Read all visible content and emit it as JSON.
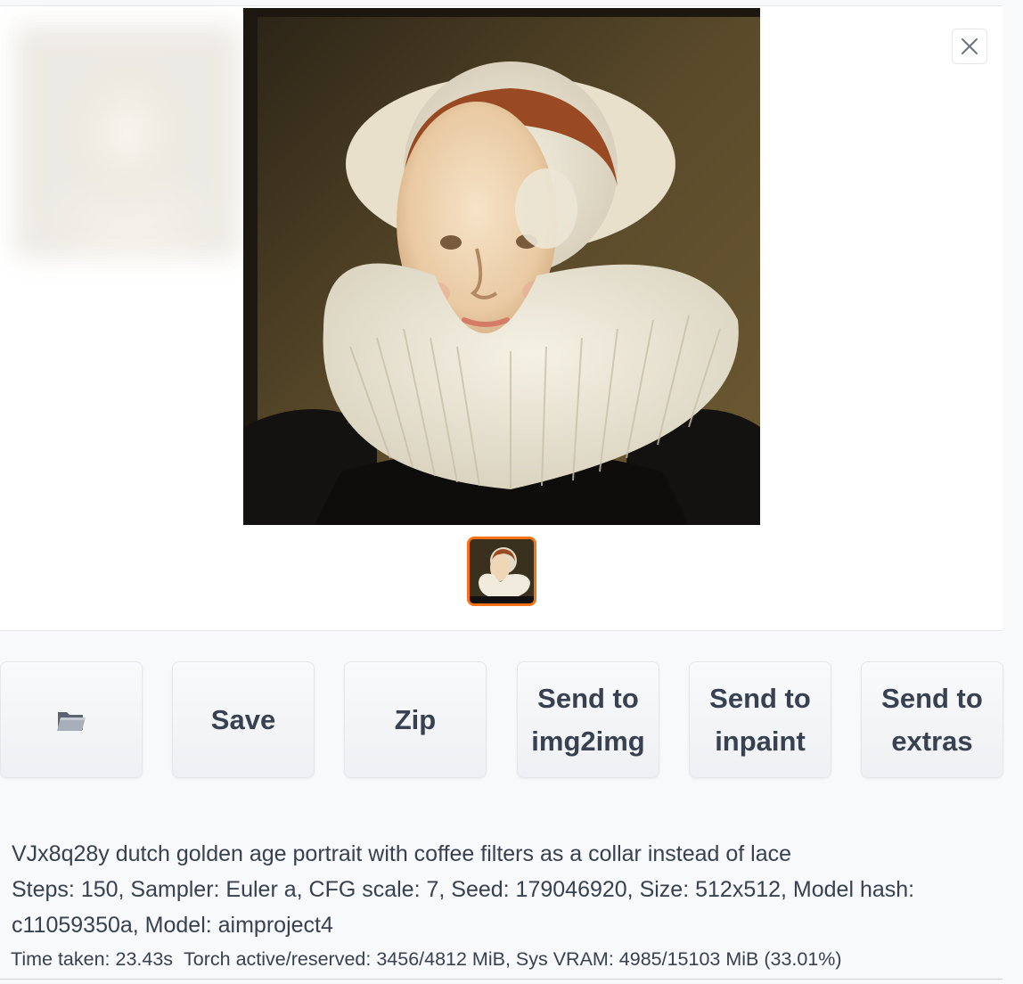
{
  "gallery": {
    "main_image_label": "dutch golden age portrait",
    "close_icon": "close-icon",
    "thumbnail_label": "selected thumbnail"
  },
  "actions": {
    "folder_icon": "folder-icon",
    "save_label": "Save",
    "zip_label": "Zip",
    "send_img2img_label": "Send to img2img",
    "send_inpaint_label": "Send to inpaint",
    "send_extras_label": "Send to extras"
  },
  "generation_info": {
    "prompt": "VJx8q28y dutch golden age portrait with coffee filters as a collar instead of lace",
    "params": "Steps: 150, Sampler: Euler a, CFG scale: 7, Seed: 179046920, Size: 512x512, Model hash: c11059350a, Model: aimproject4",
    "time_taken": "Time taken: 23.43s",
    "memory": "Torch active/reserved: 3456/4812 MiB, Sys VRAM: 4985/15103 MiB (33.01%)"
  },
  "colors": {
    "accent_orange": "#f97316",
    "text": "#374151"
  }
}
